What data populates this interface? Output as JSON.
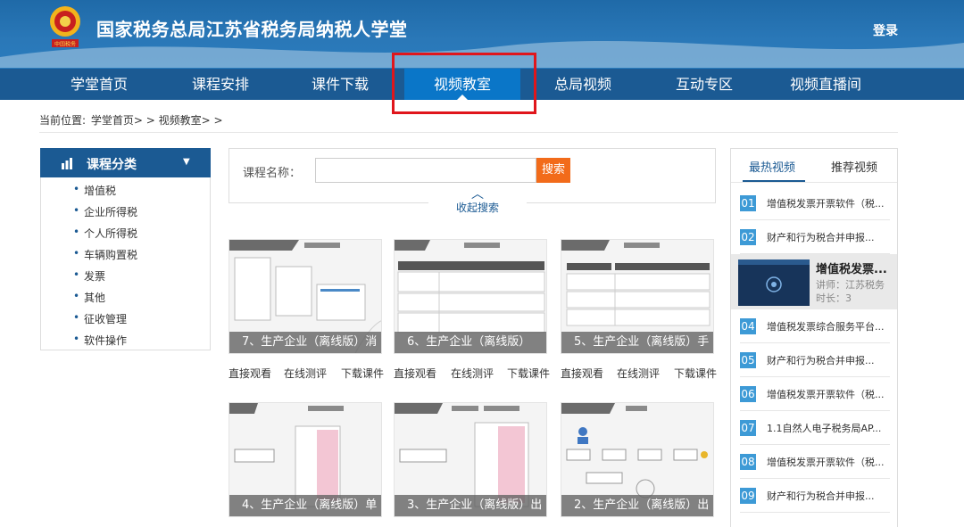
{
  "header": {
    "title": "国家税务总局江苏省税务局纳税人学堂",
    "login_label": "登录",
    "emblem_text": "中国税务"
  },
  "nav": {
    "items": [
      "学堂首页",
      "课程安排",
      "课件下载",
      "视频教室",
      "总局视频",
      "互动专区",
      "视频直播间"
    ],
    "active_index": 3
  },
  "breadcrumb": {
    "prefix": "当前位置:",
    "path": "学堂首页> > 视频教室> >"
  },
  "sidebar": {
    "heading": "课程分类",
    "categories": [
      "增值税",
      "企业所得税",
      "个人所得税",
      "车辆购置税",
      "发票",
      "其他",
      "征收管理",
      "软件操作"
    ]
  },
  "search": {
    "label": "课程名称：",
    "input_value": "",
    "button_label": "搜索",
    "collapse_label": "收起搜索"
  },
  "videos": [
    {
      "caption": "7、生产企业（离线版）消",
      "actions": [
        "直接观看",
        "在线测评",
        "下载课件"
      ]
    },
    {
      "caption": "6、生产企业（离线版）",
      "actions": [
        "直接观看",
        "在线测评",
        "下载课件"
      ]
    },
    {
      "caption": "5、生产企业（离线版）手",
      "actions": [
        "直接观看",
        "在线测评",
        "下载课件"
      ]
    },
    {
      "caption": "4、生产企业（离线版）单",
      "actions": []
    },
    {
      "caption": "3、生产企业（离线版）出",
      "actions": []
    },
    {
      "caption": "2、生产企业（离线版）出",
      "actions": []
    }
  ],
  "right_panel": {
    "tabs": [
      "最热视频",
      "推荐视频"
    ],
    "active_tab": 0,
    "ranking": [
      {
        "num": "01",
        "title": "增值税发票开票软件（税..."
      },
      {
        "num": "02",
        "title": "财产和行为税合并申报..."
      },
      {
        "num": "04",
        "title": "增值税发票综合服务平台..."
      },
      {
        "num": "05",
        "title": "财产和行为税合并申报..."
      },
      {
        "num": "06",
        "title": "增值税发票开票软件（税..."
      },
      {
        "num": "07",
        "title": "1.1自然人电子税务局AP..."
      },
      {
        "num": "08",
        "title": "增值税发票开票软件（税..."
      },
      {
        "num": "09",
        "title": "财产和行为税合并申报..."
      }
    ],
    "featured": {
      "title": "增值税发票...",
      "teacher": "讲师：江苏税务",
      "duration": "时长：3"
    }
  },
  "colors": {
    "header_blue": "#2a7cbd",
    "nav_blue": "#1b5a93",
    "active_tab": "#0a76c8",
    "search_orange": "#f26b1a",
    "highlight_red": "#e0161c",
    "rank_badge": "#3d9ad6"
  }
}
